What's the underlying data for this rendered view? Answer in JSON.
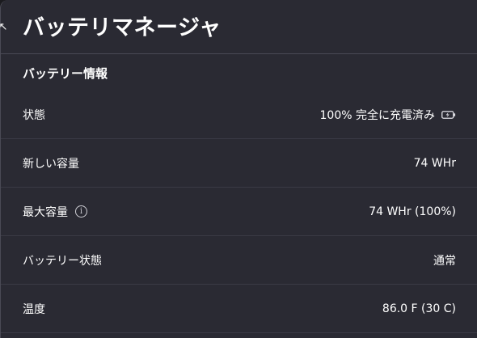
{
  "app": {
    "title": "バッテリマネージャ"
  },
  "section": {
    "title": "バッテリー情報"
  },
  "rows": [
    {
      "label": "状態",
      "value": "100% 完全に充電済み"
    },
    {
      "label": "新しい容量",
      "value": "74 WHr"
    },
    {
      "label": "最大容量",
      "value": "74 WHr (100%)"
    },
    {
      "label": "バッテリー状態",
      "value": "通常"
    },
    {
      "label": "温度",
      "value": "86.0 F (30 C)"
    }
  ],
  "icons": {
    "back": "back-arrow-icon",
    "info": "info-icon",
    "charge": "battery-charging-icon"
  },
  "colors": {
    "background": "#2a2a33",
    "text": "#ffffff",
    "divider": "#3a3a45"
  }
}
